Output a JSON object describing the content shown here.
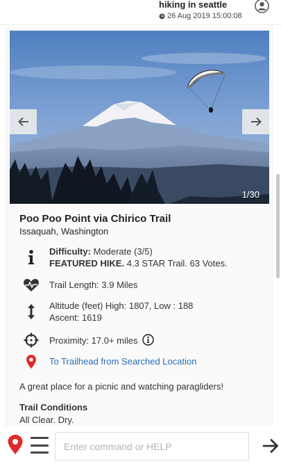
{
  "header": {
    "chat_title": "hiking in seattle",
    "timestamp": "26 Aug 2019 15:00:08"
  },
  "gallery": {
    "counter": "1/30",
    "prev_icon": "arrow-left-icon",
    "next_icon": "arrow-right-icon"
  },
  "trail": {
    "name": "Poo Poo Point via Chirico Trail",
    "location": "Issaquah, Washington",
    "difficulty_label": "Difficulty:",
    "difficulty_value": " Moderate (3/5)",
    "featured_label": "FEATURED HIKE.",
    "featured_value": " 4.3 STAR Trail. 63 Votes.",
    "length": "Trail Length: 3.9 Miles",
    "altitude": "Altitude (feet) High: 1807, Low : 188",
    "ascent": "Ascent: 1619",
    "proximity": "Proximity: 17.0+ miles",
    "trailhead_link": "To Trailhead from Searched Location",
    "description": "A great place for a picnic and watching paragliders!",
    "conditions_label": "Trail Conditions",
    "conditions_value": "All Clear. Dry."
  },
  "input": {
    "placeholder": "Enter command or HELP",
    "value": ""
  },
  "colors": {
    "pin_red": "#e02a2a",
    "link_blue": "#2a6db5",
    "heart_dark": "#333333"
  }
}
